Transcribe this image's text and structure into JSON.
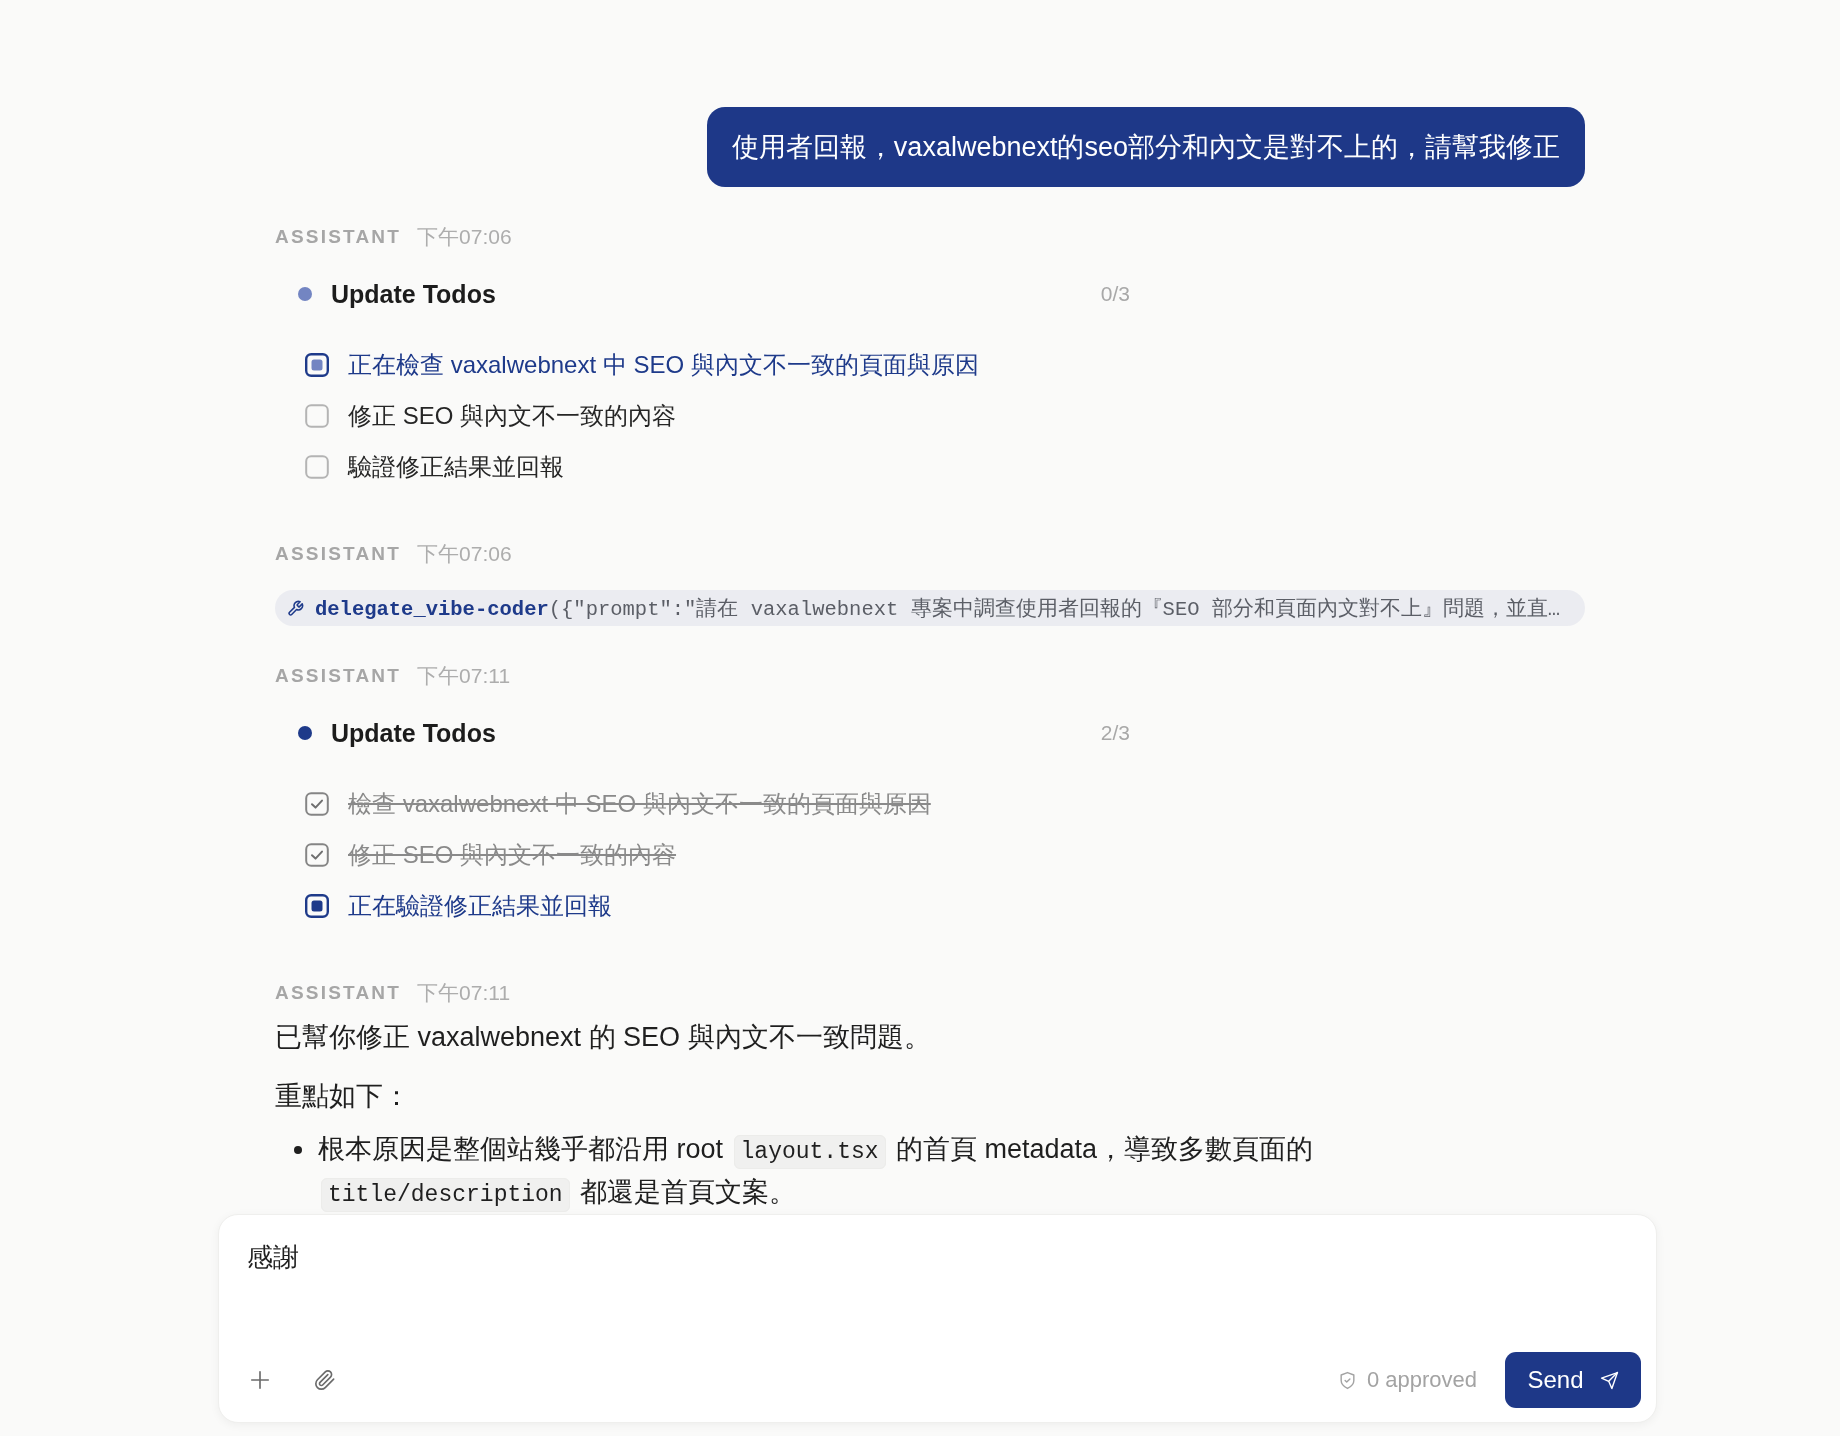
{
  "messages": [
    {
      "kind": "user",
      "text": "使用者回報，vaxalwebnext的seo部分和內文是對不上的，請幫我修正"
    },
    {
      "kind": "todos",
      "author": "ASSISTANT",
      "time": "下午07:06",
      "title": "Update Todos",
      "count": "0/3",
      "color": "#7385c2",
      "todos": [
        {
          "text": "正在檢查 vaxalwebnext 中 SEO 與內文不一致的頁面與原因",
          "checked": false,
          "active": true
        },
        {
          "text": "修正 SEO 與內文不一致的內容",
          "checked": false,
          "active": false
        },
        {
          "text": "驗證修正結果並回報",
          "checked": false,
          "active": false
        }
      ]
    },
    {
      "kind": "tool_call",
      "author": "ASSISTANT",
      "time": "下午07:06",
      "name": "delegate_vibe-coder",
      "args": "({\"prompt\":\"請在 vaxalwebnext 專案中調查使用者回報的『SEO 部分和頁面內文對不上』問題，並直…"
    },
    {
      "kind": "todos",
      "author": "ASSISTANT",
      "time": "下午07:11",
      "title": "Update Todos",
      "count": "2/3",
      "color": "#1e3a8a",
      "todos": [
        {
          "text": "檢查 vaxalwebnext 中 SEO 與內文不一致的頁面與原因",
          "checked": true,
          "active": false
        },
        {
          "text": "修正 SEO 與內文不一致的內容",
          "checked": true,
          "active": false
        },
        {
          "text": "正在驗證修正結果並回報",
          "checked": false,
          "active": true
        }
      ]
    },
    {
      "kind": "text",
      "author": "ASSISTANT",
      "time": "下午07:11",
      "paragraphs": [
        "已幫你修正 vaxalwebnext 的 SEO 與內文不一致問題。",
        "重點如下："
      ],
      "bullets": [
        {
          "parts": [
            {
              "kind": "text",
              "text": "根本原因是整個站幾乎都沿用 root "
            },
            {
              "kind": "code",
              "text": "layout.tsx"
            },
            {
              "kind": "text",
              "text": " 的首頁 metadata，導致多數頁面的 "
            },
            {
              "kind": "code",
              "text": "title/description"
            },
            {
              "kind": "text",
              "text": " 都還是首頁文案。"
            }
          ]
        }
      ]
    }
  ],
  "composer": {
    "value": "感謝",
    "approved": "0 approved",
    "send": "Send"
  }
}
